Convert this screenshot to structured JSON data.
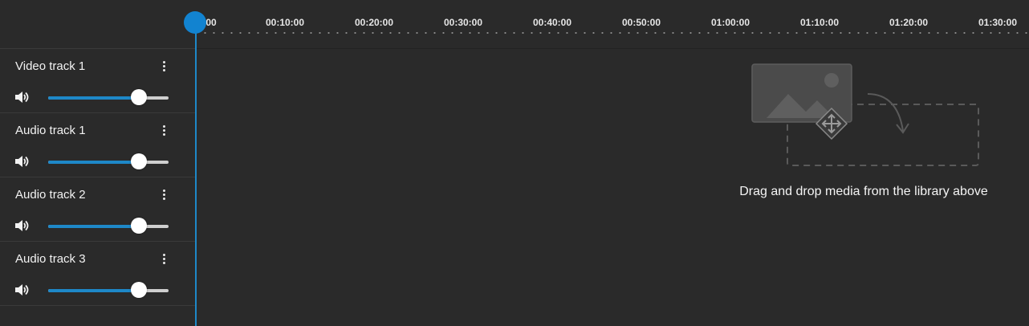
{
  "ruler": {
    "first_label_fragment": "00",
    "labels": [
      "00:10:00",
      "00:20:00",
      "00:30:00",
      "00:40:00",
      "00:50:00",
      "01:00:00",
      "01:10:00",
      "01:20:00",
      "01:30:00"
    ]
  },
  "tracks": [
    {
      "name": "Video track 1",
      "volume_percent": 75
    },
    {
      "name": "Audio track 1",
      "volume_percent": 75
    },
    {
      "name": "Audio track 2",
      "volume_percent": 75
    },
    {
      "name": "Audio track 3",
      "volume_percent": 75
    }
  ],
  "empty_state": {
    "message": "Drag and drop media from the library above",
    "icon": "drag-media-illustration-icon"
  },
  "icons": {
    "menu": "kebab-menu-icon",
    "volume": "volume-icon",
    "playhead": "playhead-icon"
  },
  "colors": {
    "accent": "#1e88c8",
    "playhead": "#1283d0",
    "background": "#2a2a2a",
    "text": "#f0f0f0"
  }
}
